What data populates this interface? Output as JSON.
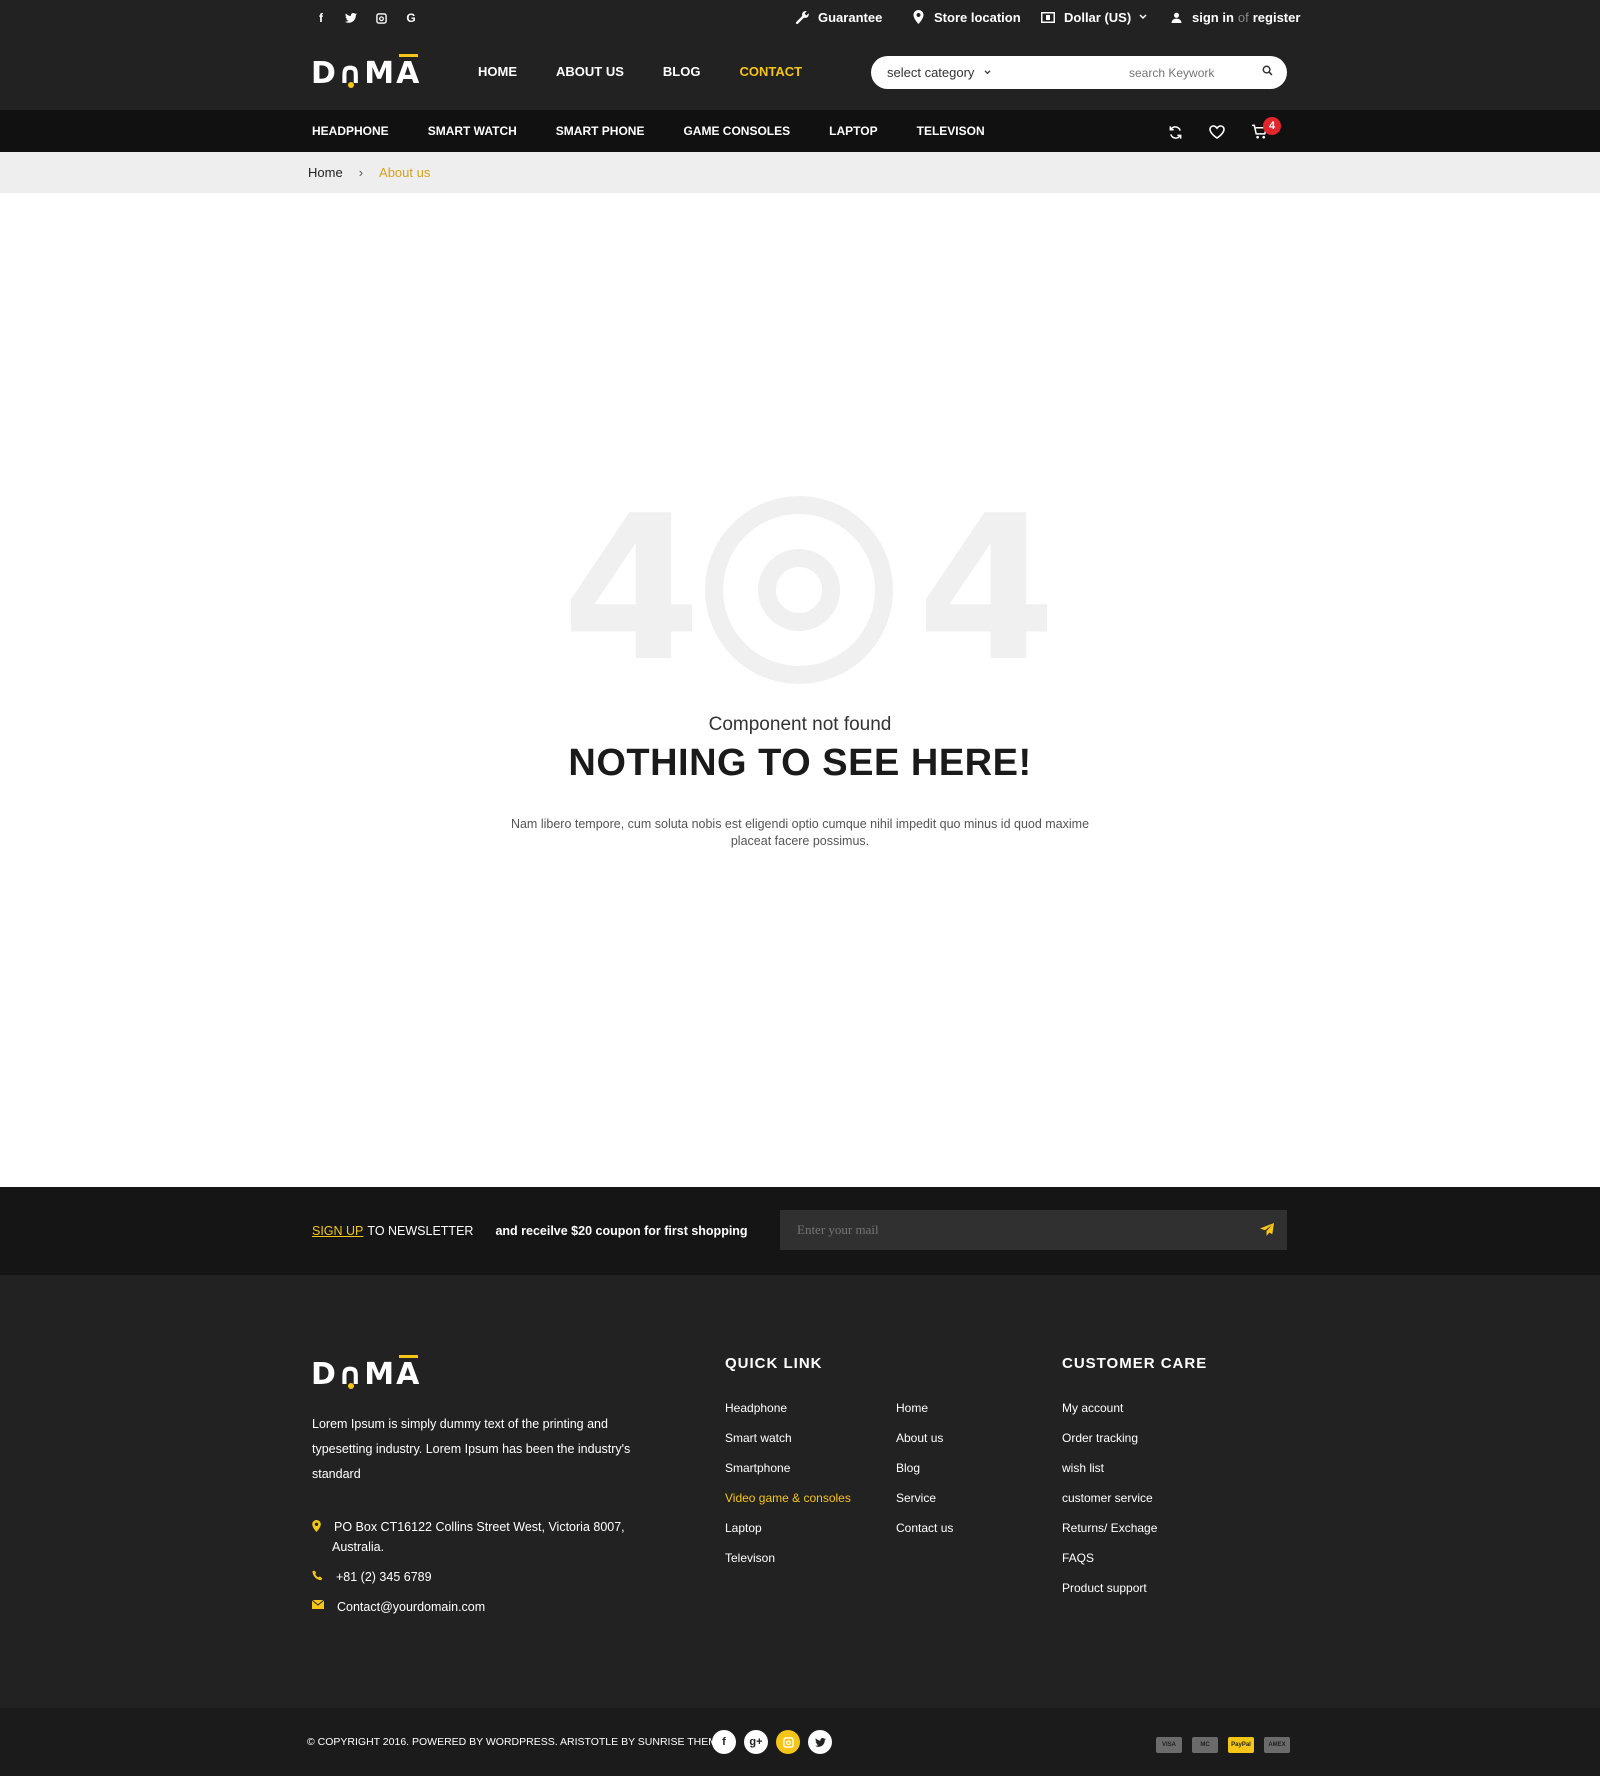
{
  "header": {
    "social": [
      "f",
      "t",
      "ig",
      "G"
    ],
    "utilities": {
      "guarantee": "Guarantee",
      "store_location": "Store location",
      "currency": "Dollar (US)",
      "sign_in": "sign in",
      "or": "of",
      "register": "register"
    },
    "logo": "DAMA",
    "nav": [
      "HOME",
      "ABOUT US",
      "BLOG",
      "CONTACT"
    ],
    "active_nav": "CONTACT",
    "search": {
      "category": "select category",
      "placeholder": "search Keywork"
    }
  },
  "category_bar": {
    "items": [
      "HEADPHONE",
      "SMART WATCH",
      "SMART PHONE",
      "GAME CONSOLES",
      "LAPTOP",
      "TELEVISON"
    ],
    "cart_count": "4"
  },
  "breadcrumb": {
    "home": "Home",
    "separator": "›",
    "current": "About us"
  },
  "error": {
    "code_left": "4",
    "code_right": "4",
    "subtitle": "Component not found",
    "title": "NOTHING TO SEE HERE!",
    "description": "Nam libero tempore, cum soluta nobis est eligendi optio cumque nihil impedit quo minus id quod maxime placeat facere possimus."
  },
  "newsletter": {
    "signup": "SIGN UP",
    "to_newsletter": "TO NEWSLETTER",
    "offer": "and receilve $20 coupon for first shopping",
    "placeholder": "Enter your mail"
  },
  "footer": {
    "about": "Lorem Ipsum is simply dummy text of the printing and typesetting industry. Lorem Ipsum has been the industry's standard",
    "address_line1": "PO Box CT16122 Collins Street West, Victoria 8007,",
    "address_line2": "Australia.",
    "phone": "+81 (2) 345 6789",
    "email": "Contact@yourdomain.com",
    "quick_link_title": "QUICK LINK",
    "quick_links_col1": [
      "Headphone",
      "Smart watch",
      "Smartphone",
      "Video game & consoles",
      "Laptop",
      "Televison"
    ],
    "quick_links_col2": [
      "Home",
      "About us",
      "Blog",
      "Service",
      "Contact us"
    ],
    "customer_care_title": "CUSTOMER CARE",
    "customer_care": [
      "My account",
      "Order tracking",
      "wish list",
      "customer service",
      "Returns/ Exchage",
      "FAQS",
      "Product support"
    ]
  },
  "bottom": {
    "copyright": "© COPYRIGHT 2016. POWERED BY WORDPRESS. ARISTOTLE  BY SUNRISE THEME",
    "social": [
      "f",
      "g+",
      "ig",
      "t"
    ],
    "payments": [
      "VISA",
      "MC",
      "PayPal",
      "AMEX"
    ]
  },
  "colors": {
    "accent": "#f5c518",
    "header_bg": "#222222",
    "catbar_bg": "#111111",
    "badge": "#e3262c"
  }
}
